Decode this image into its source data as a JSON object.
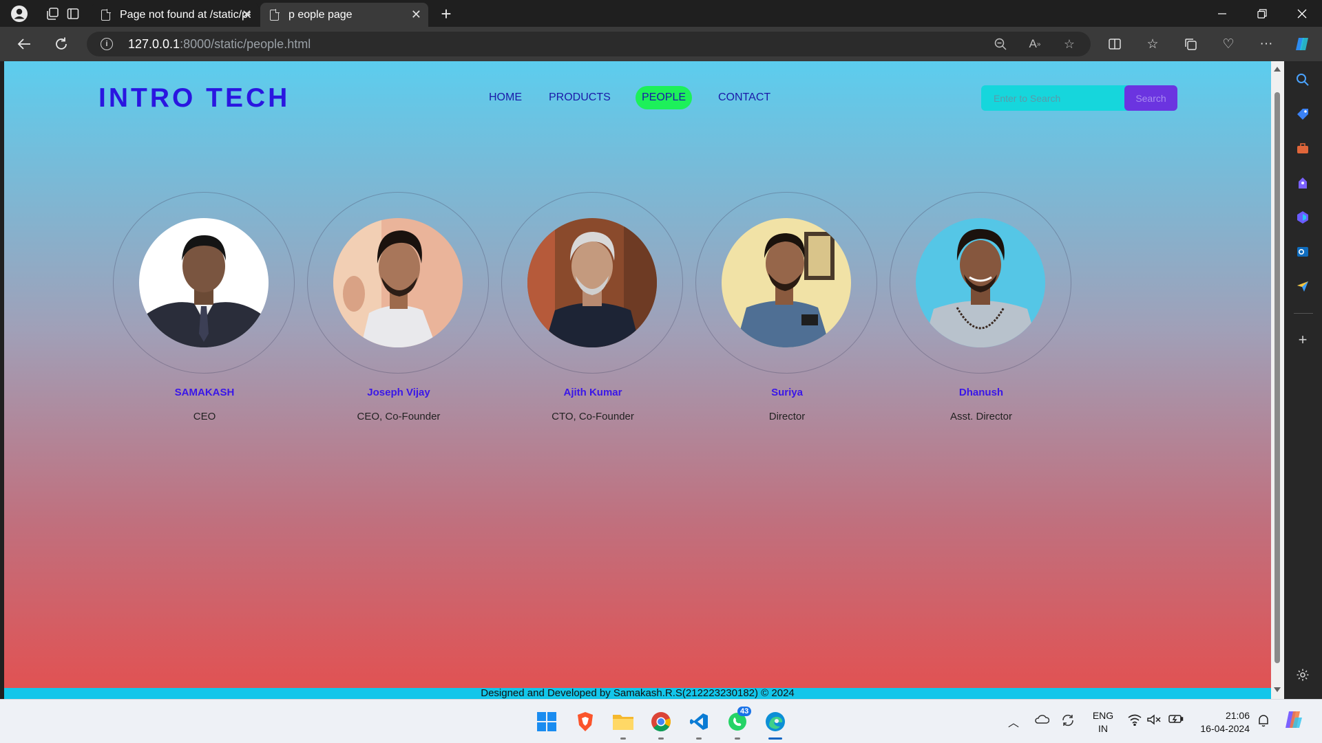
{
  "browser": {
    "tabs": [
      {
        "title": "Page not found at /static/person",
        "active": false
      },
      {
        "title": "p eople page",
        "active": true
      }
    ],
    "url_host": "127.0.0.1",
    "url_path": ":8000/static/people.html"
  },
  "site": {
    "logo": "INTRO TECH",
    "nav": [
      "HOME",
      "PRODUCTS",
      "PEOPLE",
      "CONTACT"
    ],
    "active_nav": "PEOPLE",
    "search_placeholder": "Enter to Search",
    "search_button": "Search",
    "people": [
      {
        "name": "SAMAKASH",
        "role": "CEO"
      },
      {
        "name": "Joseph Vijay",
        "role": "CEO, Co-Founder"
      },
      {
        "name": "Ajith Kumar",
        "role": "CTO, Co-Founder"
      },
      {
        "name": "Suriya",
        "role": "Director"
      },
      {
        "name": "Dhanush",
        "role": "Asst. Director"
      }
    ],
    "footer": "Designed and Developed by Samakash.R.S(212223230182) © 2024"
  },
  "taskbar": {
    "whatsapp_badge": "43",
    "lang_line1": "ENG",
    "lang_line2": "IN",
    "time": "21:06",
    "date": "16-04-2024"
  },
  "colors": {
    "logo": "#2a16e0",
    "active_nav_bg": "#1df05a",
    "search_bg": "#16d6dc",
    "search_button_bg": "#6b34e0",
    "footer_bg": "#13c6ea",
    "gradient_top": "#5ccdee",
    "gradient_bottom": "#e35050"
  }
}
